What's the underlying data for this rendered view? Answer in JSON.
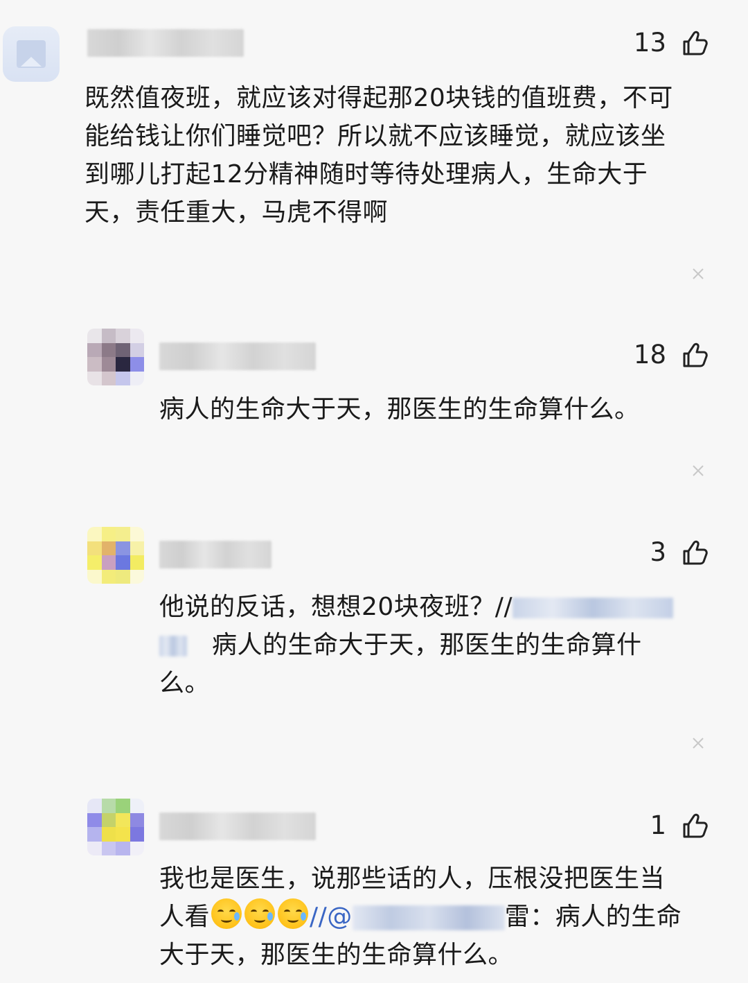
{
  "comments": [
    {
      "likes": "13",
      "text": "既然值夜班，就应该对得起那20块钱的值班费，不可能给钱让你们睡觉吧？所以就不应该睡觉，就应该坐到哪儿打起12分精神随时等待处理病人，生命大于天，责任重大，马虎不得啊",
      "lines": [
        "既然值夜班，就应该对得起那20块钱的值班费，不可",
        "能给钱让你们睡觉吧？所以就不应该睡觉，就应该坐",
        "到哪儿打起12分精神随时等待处理病人，生命大于",
        "天，责任重大，马虎不得啊"
      ]
    },
    {
      "likes": "18",
      "text": "病人的生命大于天，那医生的生命算什么。"
    },
    {
      "likes": "3",
      "line1_a": "他说的反话，想想20块夜班？//",
      "line2": "病人的生命大于天，那医生的生命算什",
      "line3": "么。"
    },
    {
      "likes": "1",
      "line1": "我也是医生，说那些话的人，压根没把医生当",
      "line2_a": "人看",
      "line2_b": "//@",
      "line2_c": "雷：病人的生命",
      "line3": "大于天，那医生的生命算什么。"
    }
  ],
  "icons": {
    "like": "thumbs-up-icon",
    "close": "close-icon"
  },
  "colors": {
    "background": "#f7f7f7",
    "text": "#1a1a1a",
    "mention": "#3a66c4",
    "close": "#c8c8c8"
  }
}
